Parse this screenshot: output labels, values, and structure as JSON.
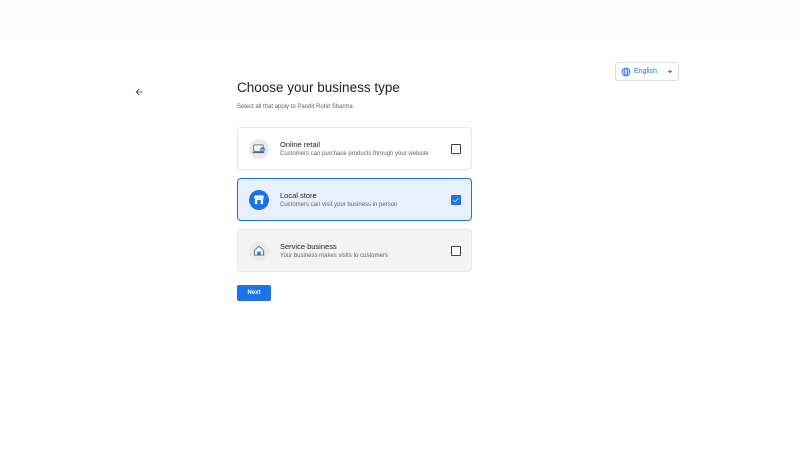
{
  "language": {
    "selected": "English"
  },
  "page": {
    "title": "Choose your business type",
    "subtitle": "Select all that apply to Pandit Rohit Sharma"
  },
  "options": [
    {
      "title": "Online retail",
      "description": "Customers can purchase products through your website",
      "checked": false,
      "icon": "laptop-cart-icon"
    },
    {
      "title": "Local store",
      "description": "Customers can visit your business in person",
      "checked": true,
      "icon": "storefront-icon"
    },
    {
      "title": "Service business",
      "description": "Your business makes visits to customers",
      "checked": false,
      "icon": "service-van-icon"
    }
  ],
  "actions": {
    "next_label": "Next"
  },
  "colors": {
    "accent": "#1a73e8",
    "selected_bg": "#e8f0fe"
  }
}
